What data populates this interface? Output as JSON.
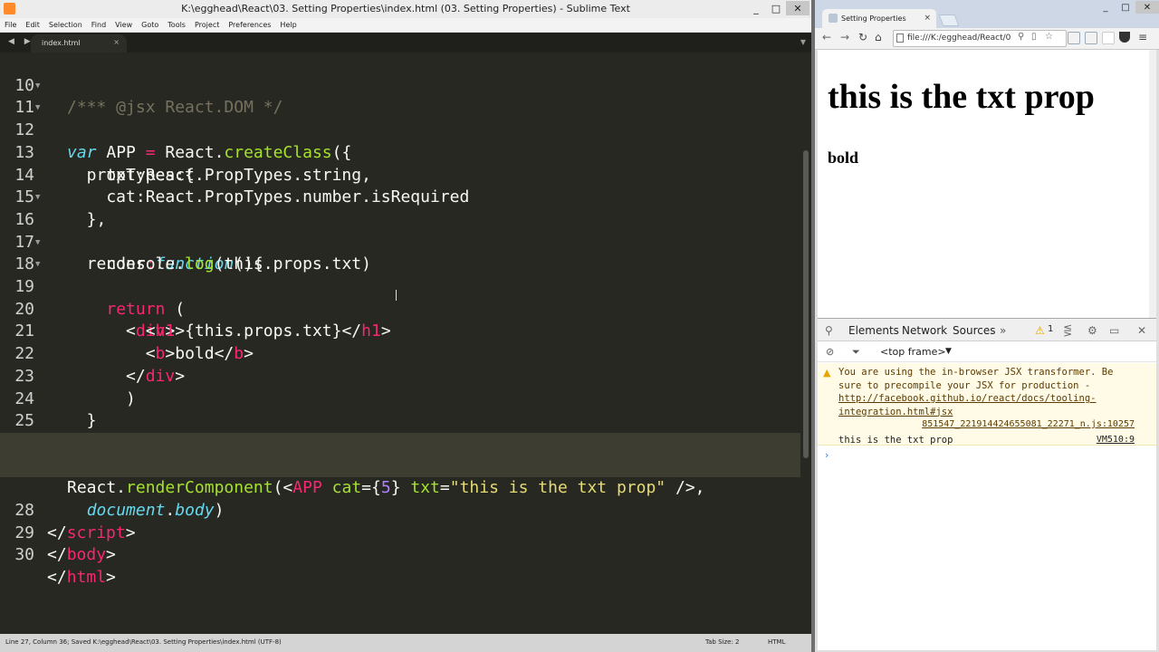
{
  "sublime": {
    "title": "K:\\egghead\\React\\03. Setting Properties\\index.html (03. Setting Properties) - Sublime Text",
    "window_buttons": [
      "_",
      "□",
      "✕"
    ],
    "menu": [
      "File",
      "Edit",
      "Selection",
      "Find",
      "View",
      "Goto",
      "Tools",
      "Project",
      "Preferences",
      "Help"
    ],
    "tab": {
      "name": "index.html",
      "close": "×"
    },
    "nav_arrows": "◀ ▶",
    "tab_dropdown": "▼",
    "line_numbers": [
      "10",
      "11",
      "12",
      "13",
      "14",
      "15",
      "16",
      "17",
      "18",
      "19",
      "20",
      "21",
      "22",
      "23",
      "24",
      "25",
      "26",
      "27",
      "",
      "28",
      "29",
      "30"
    ],
    "status": {
      "left": "Line 27, Column 36; Saved K:\\egghead\\React\\03. Setting Properties\\index.html (UTF-8)",
      "tab_size": "Tab Size: 2",
      "syntax": "HTML"
    }
  },
  "code": {
    "l10": [
      "/*** @jsx React.DOM */"
    ],
    "l11": [
      "var",
      " APP ",
      "=",
      " React.",
      "createClass",
      "({"
    ],
    "l12": [
      "  propTypes:{"
    ],
    "l13": [
      "    txt:React.PropTypes.string,"
    ],
    "l14": [
      "    cat:React.PropTypes.number.isRequired"
    ],
    "l15": [
      "  },"
    ],
    "l16": [
      "  render",
      ":",
      "function",
      "(){"
    ],
    "l17": [
      "    console.",
      "log",
      "(this.props.txt)"
    ],
    "l18": [
      "    ",
      "return",
      " ("
    ],
    "l19": [
      "      <",
      "div",
      ">"
    ],
    "l20": [
      "        <",
      "h1",
      ">{this.props.txt}</",
      "h1",
      ">"
    ],
    "l21": [
      "        <",
      "b",
      ">bold</",
      "b",
      ">"
    ],
    "l22": [
      "      </",
      "div",
      ">"
    ],
    "l23": [
      "      )"
    ],
    "l24": [
      "  }"
    ],
    "l25": [
      "});"
    ],
    "l27": [
      "React.",
      "renderComponent",
      "(<",
      "APP",
      " ",
      "cat",
      "={",
      "5",
      "} ",
      "txt",
      "=",
      "\"this is the txt prop\"",
      " />,"
    ],
    "l27b": [
      "  ",
      "document",
      ".",
      "body",
      ")"
    ],
    "l28": [
      "</",
      "script",
      ">"
    ],
    "l29": [
      "</",
      "body",
      ">"
    ],
    "l30": [
      "</",
      "html",
      ">"
    ]
  },
  "browser": {
    "tab_title": "Setting Properties",
    "tab_close": "×",
    "window_buttons": [
      "_",
      "□",
      "✕"
    ],
    "nav": [
      "←",
      "→",
      "↻",
      "⌂"
    ],
    "url": "file:///K:/egghead/React/0",
    "page": {
      "h1": "this is the txt prop",
      "bold": "bold"
    }
  },
  "devtools": {
    "tabs": [
      "Elements",
      "Network",
      "Sources",
      "»"
    ],
    "warning_count": "1",
    "frame_selector": "<top frame>",
    "warning_text": "You are using the in-browser JSX transformer. Be sure to precompile your JSX for production - ",
    "warning_link": "http://facebook.github.io/react/docs/tooling-integration.html#jsx",
    "warning_source": "851547_221914424655081_22271_n.js:10257",
    "log_text": "this is the txt prop",
    "log_source": "VM510:9",
    "prompt": "›"
  },
  "colors": {
    "editor_bg": "#272822",
    "keyword": "#66d9ef",
    "tag": "#f92672",
    "function": "#a6e22e",
    "string": "#e6db74",
    "number": "#ae81ff",
    "comment": "#75715e"
  }
}
